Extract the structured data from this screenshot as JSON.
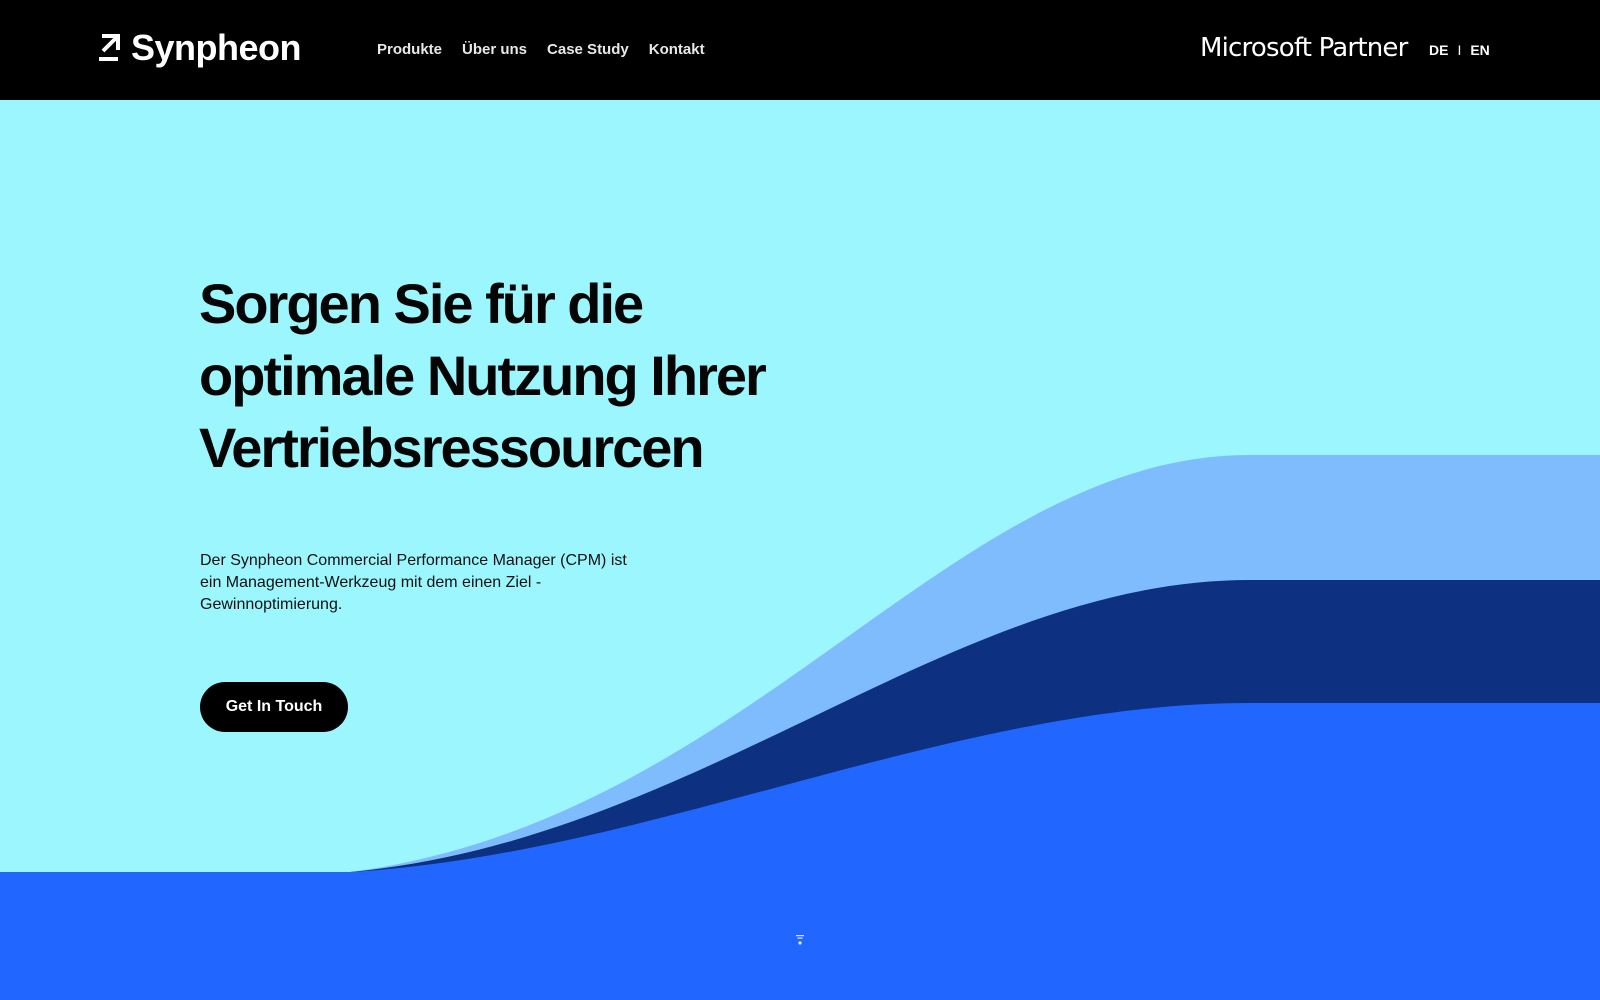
{
  "header": {
    "brand": "Synpheon",
    "nav": [
      "Produkte",
      "Über uns",
      "Case Study",
      "Kontakt"
    ],
    "partner_badge": "Microsoft Partner",
    "languages": {
      "de": "DE",
      "separator": "I",
      "en": "EN",
      "active": "DE"
    }
  },
  "hero": {
    "headline": "Sorgen Sie für die optimale Nutzung Ihrer Vertriebsressourcen",
    "lead": "Der Synpheon Commercial Performance Manager (CPM) ist ein Management-Werkzeug mit dem einen Ziel - Gewinnoptimierung.",
    "cta_label": "Get In Touch"
  },
  "colors": {
    "header_bg": "#000000",
    "hero_bg": "#9cf6fd",
    "wave_light": "#7fbcfd",
    "wave_dark": "#0d3080",
    "wave_bright": "#2066ff",
    "cta_bg": "#000000"
  },
  "icons": {
    "logo_mark": "arrow-up-right-icon",
    "scroll_hint": "scroll-down-icon"
  }
}
